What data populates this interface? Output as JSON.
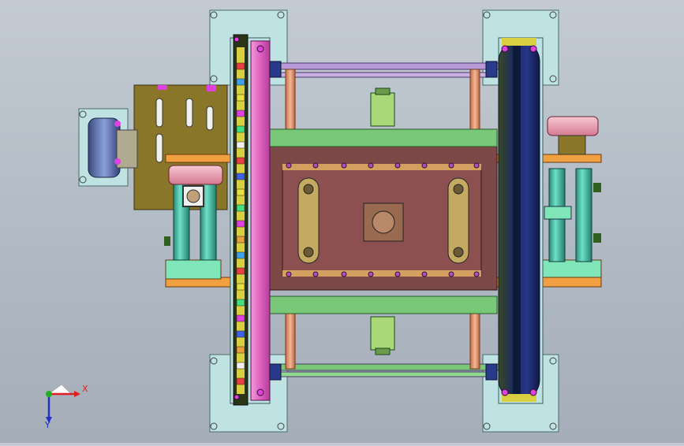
{
  "viewport": {
    "background_top": "#c3cad3",
    "background_bottom": "#a4adb8"
  },
  "triad": {
    "x_label": "X",
    "y_label": "Y",
    "x_color": "#e02020",
    "y_color": "#2030c8",
    "origin_color": "#20b020"
  },
  "part_colors": {
    "plate_cyan": "#bfe3e3",
    "motor_mount": "#8a7628",
    "frame_orange": "#f0a040",
    "body_maroon": "#7d4848",
    "beam_green": "#78c878",
    "rail_purple": "#b89ad8",
    "wheel_pink": "#e070c8",
    "wheel_dark": "#1e2a6a",
    "cylinder_teal": "#3fb8a0",
    "flange_pink": "#e8a0b0",
    "rod_copper": "#e8a070"
  }
}
